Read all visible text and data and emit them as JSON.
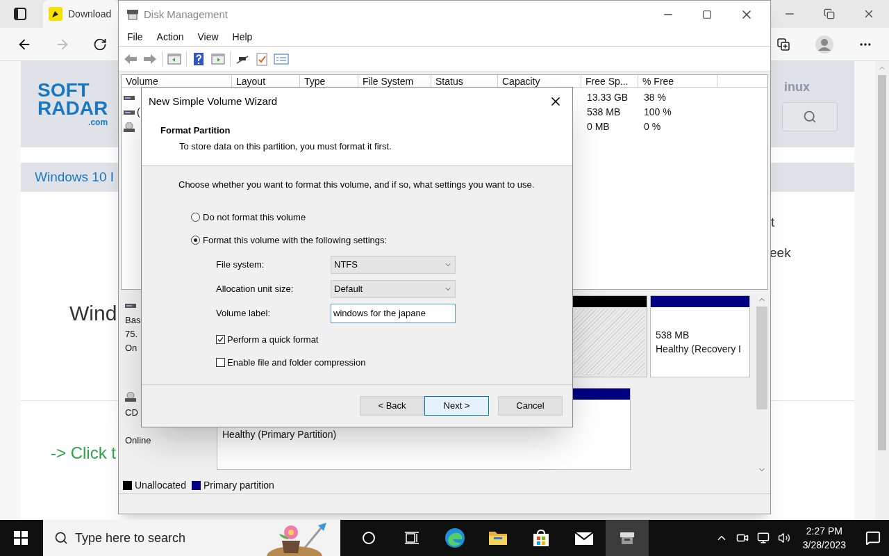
{
  "browser": {
    "tab_title": "Download",
    "page": {
      "logo": {
        "line1": "SOFT",
        "line2": "RADAR",
        "suffix": ".com"
      },
      "header_link": "inux",
      "nav_link": "Windows 10 I",
      "heading": "Wind",
      "side_texts": [
        "t",
        "eek"
      ],
      "link": "-> Click t"
    }
  },
  "disk_management": {
    "title": "Disk Management",
    "menu": [
      "File",
      "Action",
      "View",
      "Help"
    ],
    "columns": [
      "Volume",
      "Layout",
      "Type",
      "File System",
      "Status",
      "Capacity",
      "Free Sp...",
      "% Free"
    ],
    "volume_rows": [
      {
        "free": "13.33 GB",
        "percent": "38 %"
      },
      {
        "volume": "(",
        "free": "538 MB",
        "percent": "100 %"
      },
      {
        "free": "0 MB",
        "percent": "0 %"
      }
    ],
    "disks": [
      {
        "kind": "hdd",
        "lines": [
          "Bas",
          "75.",
          "On"
        ],
        "partitions": [
          {
            "kind": "unallocated"
          },
          {
            "kind": "primary",
            "lines": [
              "538 MB",
              "Healthy (Recovery I"
            ]
          }
        ]
      },
      {
        "kind": "cd",
        "lines": [
          "CD",
          "Online"
        ],
        "partitions": [
          {
            "kind": "primary",
            "lines": [
              "Healthy (Primary Partition)"
            ]
          }
        ]
      }
    ],
    "legend": [
      {
        "label": "Unallocated",
        "color": "#000000"
      },
      {
        "label": "Primary partition",
        "color": "#000080"
      }
    ]
  },
  "wizard": {
    "title": "New Simple Volume Wizard",
    "heading": "Format Partition",
    "subheading": "To store data on this partition, you must format it first.",
    "instruction": "Choose whether you want to format this volume, and if so, what settings you want to use.",
    "options": [
      {
        "label": "Do not format this volume",
        "selected": false
      },
      {
        "label": "Format this volume with the following settings:",
        "selected": true
      }
    ],
    "fields": [
      {
        "kind": "select",
        "label": "File system:",
        "value": "NTFS"
      },
      {
        "kind": "select",
        "label": "Allocation unit size:",
        "value": "Default"
      },
      {
        "kind": "text",
        "label": "Volume label:",
        "value": "windows for the japane"
      }
    ],
    "checkboxes": [
      {
        "label": "Perform a quick format",
        "checked": true
      },
      {
        "label": "Enable file and folder compression",
        "checked": false
      }
    ],
    "buttons": [
      {
        "label": "< Back",
        "selected": false
      },
      {
        "label": "Next >",
        "selected": true
      },
      {
        "label": "Cancel",
        "selected": false
      }
    ]
  },
  "taskbar": {
    "search_placeholder": "Type here to search",
    "apps": [
      {
        "kind": "cortana",
        "selected": false
      },
      {
        "kind": "taskview",
        "selected": false
      },
      {
        "kind": "edge",
        "selected": false
      },
      {
        "kind": "folder",
        "selected": false
      },
      {
        "kind": "store",
        "selected": false
      },
      {
        "kind": "mail",
        "selected": false
      },
      {
        "kind": "disk",
        "selected": true
      }
    ],
    "time": "2:27 PM",
    "date": "3/28/2023"
  }
}
